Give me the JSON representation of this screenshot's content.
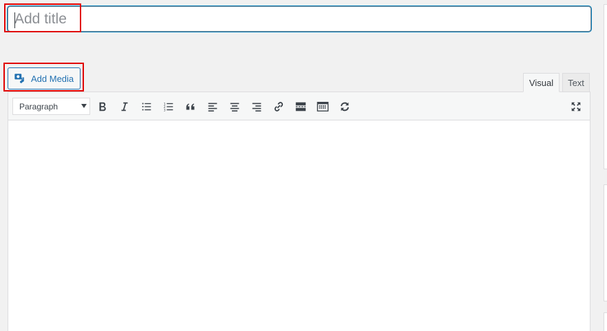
{
  "title": {
    "placeholder": "Add title"
  },
  "media": {
    "add_media_label": "Add Media"
  },
  "tabs": {
    "visual": "Visual",
    "text": "Text"
  },
  "toolbar": {
    "format_value": "Paragraph",
    "buttons": [
      "bold-icon",
      "italic-icon",
      "bulleted-list-icon",
      "numbered-list-icon",
      "blockquote-icon",
      "align-left-icon",
      "align-center-icon",
      "align-right-icon",
      "link-icon",
      "read-more-icon",
      "toolbar-toggle-icon",
      "undo-redo-icon",
      "fullscreen-icon"
    ]
  },
  "colors": {
    "accent": "#2271b1",
    "highlight": "#e00000",
    "focus": "#007cba"
  }
}
